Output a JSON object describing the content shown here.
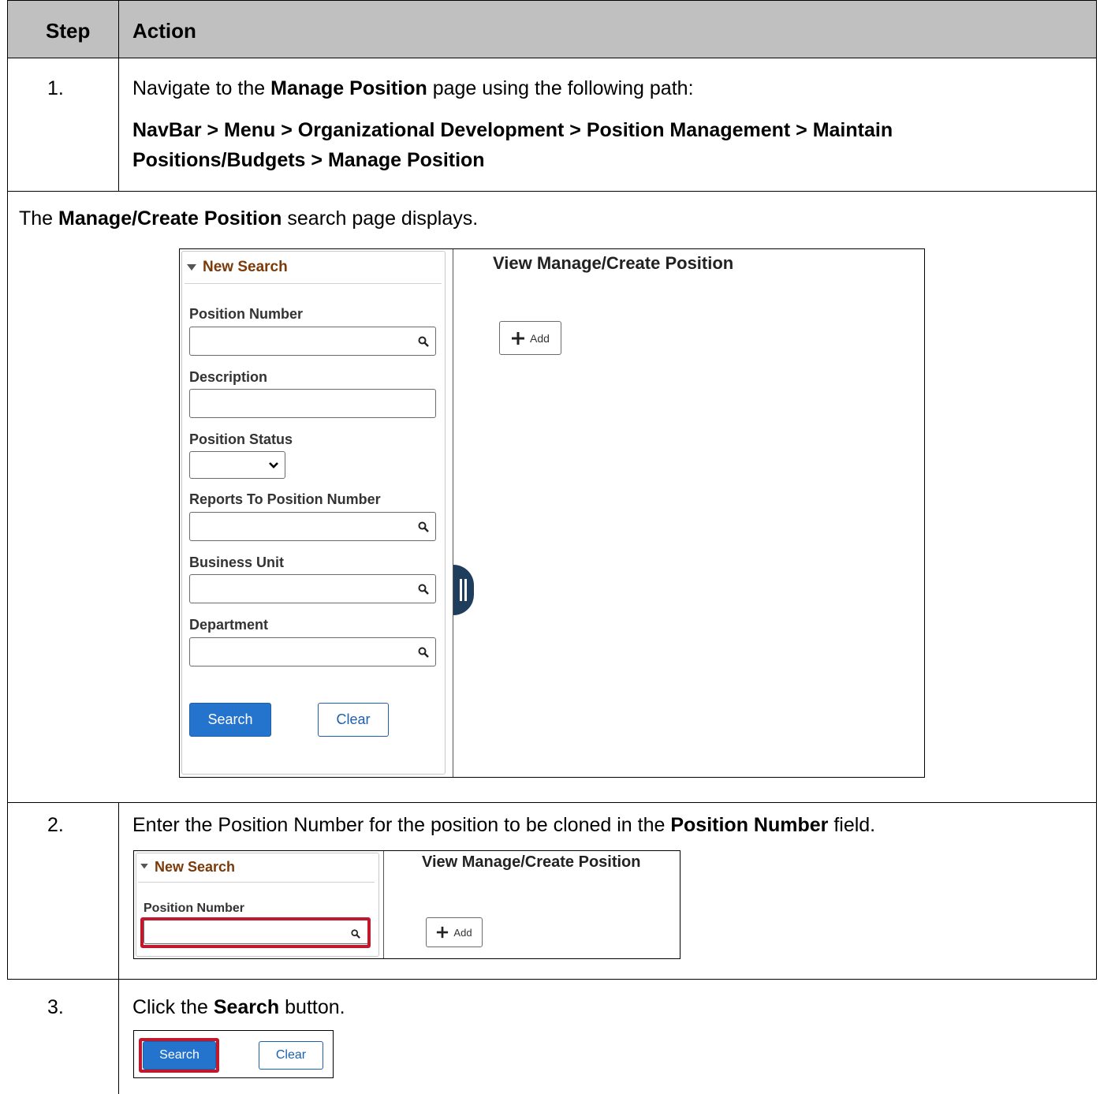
{
  "table": {
    "header": {
      "step": "Step",
      "action": "Action"
    },
    "row1": {
      "step": "1.",
      "line_pre": "Navigate to the ",
      "line_bold": "Manage Position",
      "line_post": " page using the following path:",
      "path_line1": "NavBar > Menu > Organizational Development > Position Management > Maintain",
      "path_line2": "Positions/Budgets > Manage Position"
    },
    "note": {
      "pre": "The ",
      "bold": "Manage/Create Position",
      "post": " search page displays."
    },
    "row2": {
      "step": "2.",
      "pre": "Enter the Position Number for the position to be cloned in the ",
      "bold": "Position Number",
      "post": " field."
    },
    "row3": {
      "step": "3.",
      "pre": "Click the ",
      "bold": "Search",
      "post": " button."
    }
  },
  "screenshot_main": {
    "new_search": "New Search",
    "title": "View Manage/Create Position",
    "add_label": "Add",
    "fields": {
      "position_number": "Position Number",
      "description": "Description",
      "position_status": "Position Status",
      "reports_to": "Reports To Position Number",
      "business_unit": "Business Unit",
      "department": "Department"
    },
    "search_button": "Search",
    "clear_button": "Clear"
  },
  "screenshot_step2": {
    "new_search": "New Search",
    "title": "View Manage/Create Position",
    "position_number": "Position Number",
    "add_label": "Add"
  },
  "screenshot_step3": {
    "search_button": "Search",
    "clear_button": "Clear"
  },
  "colors": {
    "header_bg": "#c0c0c0",
    "primary_button": "#2473cc",
    "highlight": "#c0182c",
    "new_search_text": "#7a3a0a",
    "splitter": "#1f3d5c"
  }
}
